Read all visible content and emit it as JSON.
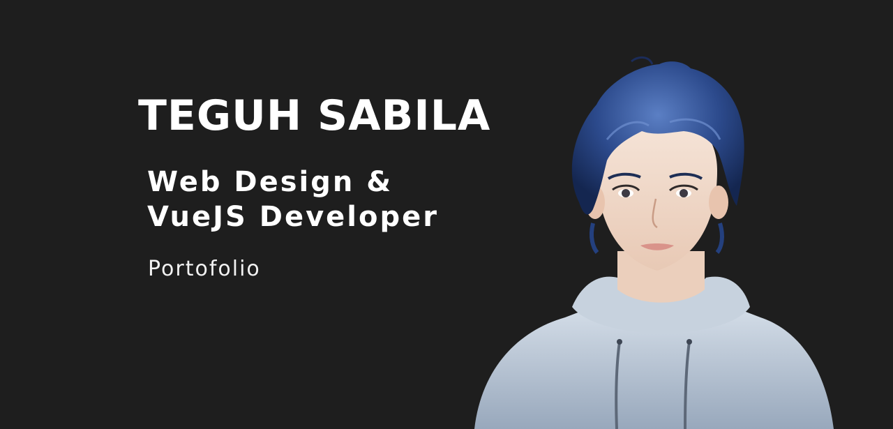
{
  "hero": {
    "name": "TEGUH SABILA",
    "role_line_1": "Web Design &",
    "role_line_2": "VueJS Developer",
    "subtitle": "Portofolio"
  },
  "portrait": {
    "icon": "developer-avatar-illustration",
    "hair_color": "#24407e",
    "skin_color": "#f1dccd",
    "hoodie_color": "#b4c1d0"
  },
  "colors": {
    "background": "#1e1e1e",
    "text": "#ffffff"
  }
}
